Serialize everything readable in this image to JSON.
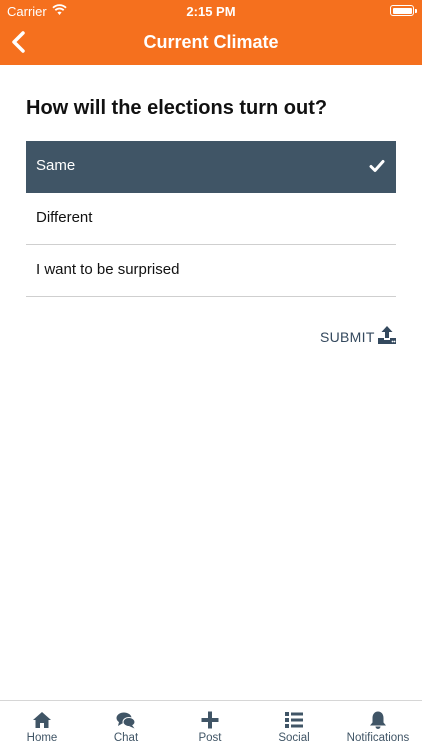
{
  "status_bar": {
    "carrier": "Carrier",
    "time": "2:15 PM"
  },
  "header": {
    "title": "Current Climate",
    "back_icon": "chevron-left-icon",
    "background_color": "#f5701e"
  },
  "poll": {
    "question": "How will the elections turn out?",
    "options": [
      {
        "label": "Same",
        "selected": true
      },
      {
        "label": "Different",
        "selected": false
      },
      {
        "label": "I want to be surprised",
        "selected": false
      }
    ],
    "selected_color": "#405566"
  },
  "submit": {
    "label": "SUBMIT",
    "icon": "upload-icon"
  },
  "tabbar": {
    "items": [
      {
        "label": "Home",
        "icon": "home-icon"
      },
      {
        "label": "Chat",
        "icon": "chat-icon"
      },
      {
        "label": "Post",
        "icon": "plus-icon"
      },
      {
        "label": "Social",
        "icon": "list-icon"
      },
      {
        "label": "Notifications",
        "icon": "bell-icon"
      }
    ],
    "icon_color": "#405566"
  }
}
